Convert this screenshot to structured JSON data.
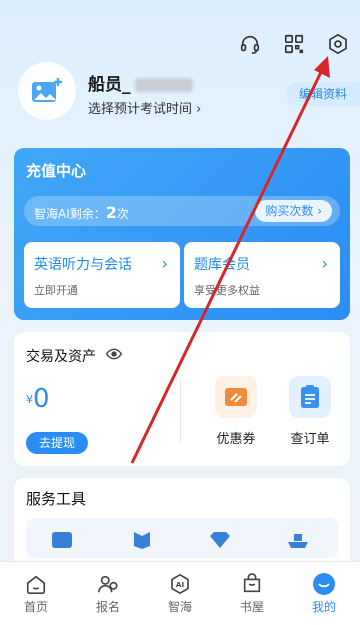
{
  "header": {
    "icons": [
      "headset-icon",
      "qr-scan-icon",
      "settings-icon"
    ]
  },
  "profile": {
    "name": "船员_",
    "exam_time": "选择预计考试时间 ›",
    "edit": "编辑资料"
  },
  "recharge": {
    "title": "充值中心",
    "quota_label": "智海AI剩余：",
    "quota_count": "2",
    "quota_unit": "次",
    "buy": "购买次数 ›",
    "cards": [
      {
        "title": "英语听力与会话",
        "sub": "立即开通",
        "arrow": "›"
      },
      {
        "title": "题库会员",
        "sub": "享受更多权益",
        "arrow": "›"
      }
    ]
  },
  "assets": {
    "title": "交易及资产",
    "currency": "¥",
    "amount": "0",
    "withdraw": "去提现",
    "tiles": [
      {
        "label": "优惠券"
      },
      {
        "label": "查订单"
      }
    ]
  },
  "services": {
    "title": "服务工具"
  },
  "tabbar": [
    {
      "label": "首页",
      "icon": "home-icon"
    },
    {
      "label": "报名",
      "icon": "register-icon"
    },
    {
      "label": "智海",
      "icon": "ai-icon"
    },
    {
      "label": "书屋",
      "icon": "bookstore-icon"
    },
    {
      "label": "我的",
      "icon": "profile-icon",
      "active": true
    }
  ],
  "colors": {
    "accent": "#2b8df4",
    "annotation_arrow": "#d6262a"
  }
}
